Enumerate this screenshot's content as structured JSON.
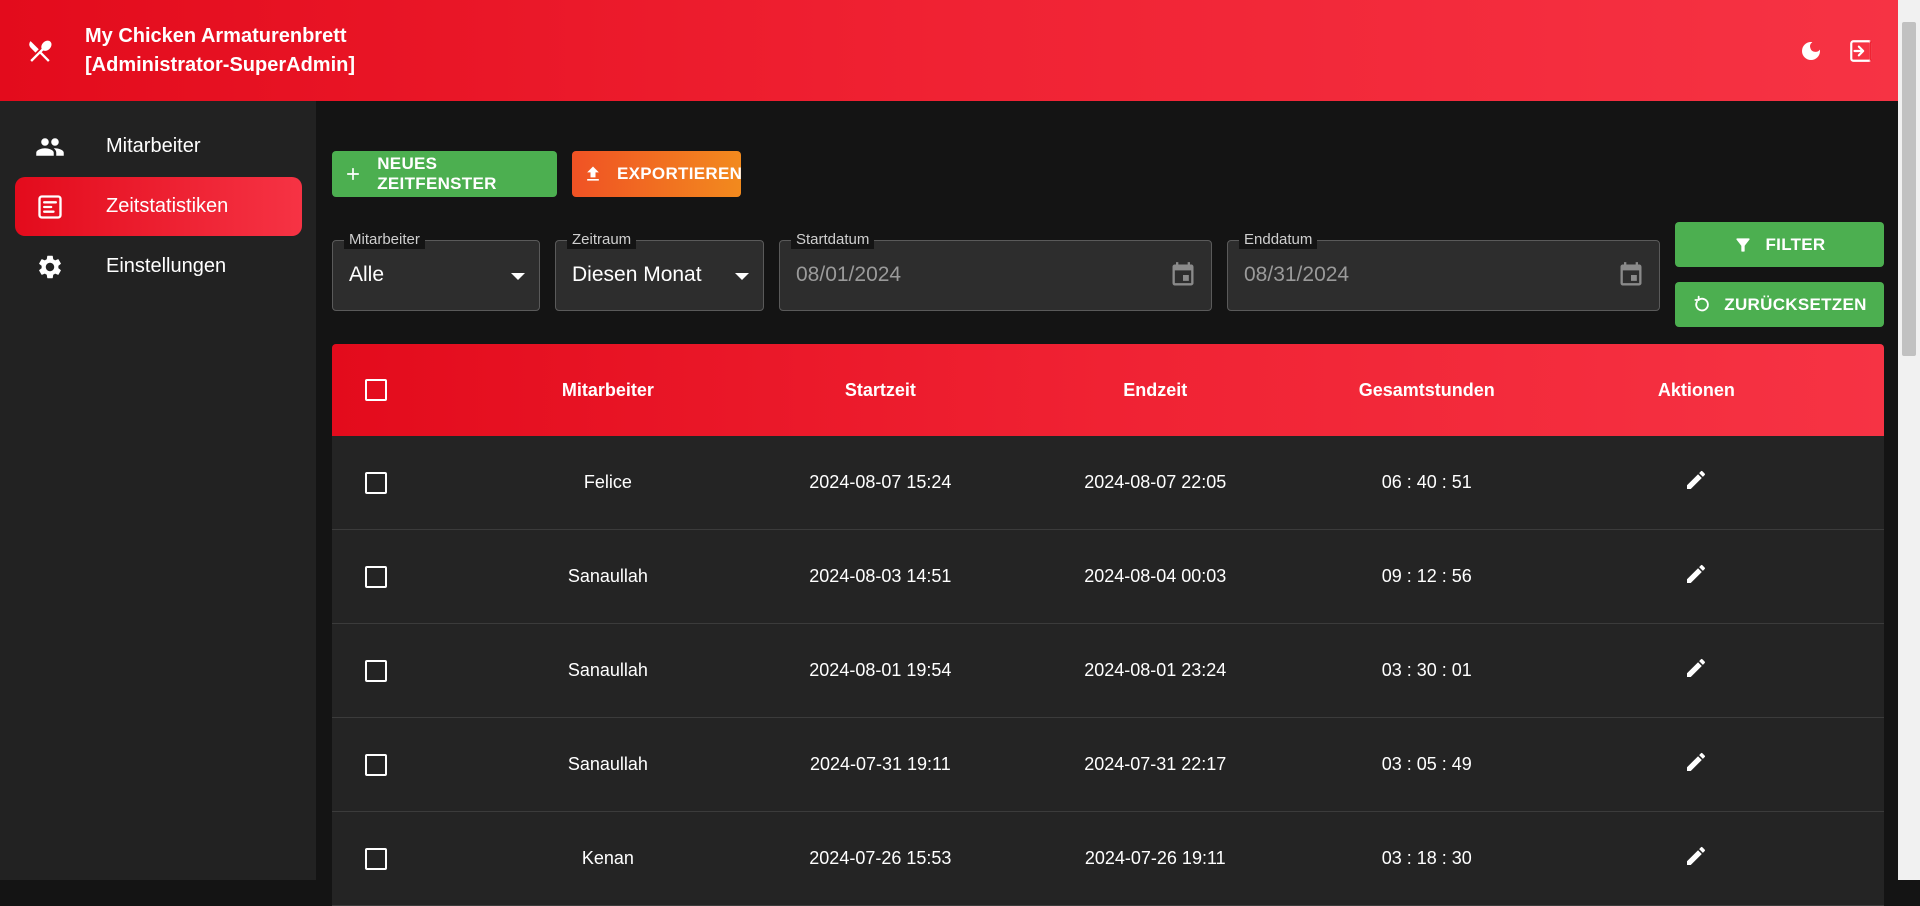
{
  "header": {
    "logo_icon": "utensils-icon",
    "title_line1": "My Chicken Armaturenbrett",
    "title_line2": "[Administrator-SuperAdmin]",
    "theme_icon": "moon-icon",
    "logout_icon": "logout-icon"
  },
  "sidebar": {
    "items": [
      {
        "label": "Mitarbeiter",
        "icon": "people-icon",
        "active": false
      },
      {
        "label": "Zeitstatistiken",
        "icon": "report-icon",
        "active": true
      },
      {
        "label": "Einstellungen",
        "icon": "gear-icon",
        "active": false
      }
    ]
  },
  "toolbar": {
    "new_label": "NEUES ZEITFENSTER",
    "export_label": "EXPORTIEREN",
    "filter_label": "FILTER",
    "reset_label": "ZURÜCKSETZEN"
  },
  "filters": {
    "employee": {
      "label": "Mitarbeiter",
      "value": "Alle"
    },
    "period": {
      "label": "Zeitraum",
      "value": "Diesen Monat"
    },
    "start": {
      "label": "Startdatum",
      "value": "08/01/2024"
    },
    "end": {
      "label": "Enddatum",
      "value": "08/31/2024"
    }
  },
  "table": {
    "columns": [
      "Mitarbeiter",
      "Startzeit",
      "Endzeit",
      "Gesamtstunden",
      "Aktionen"
    ],
    "rows": [
      {
        "employee": "Felice",
        "start": "2024-08-07 15:24",
        "end": "2024-08-07 22:05",
        "total": "06 : 40 : 51"
      },
      {
        "employee": "Sanaullah",
        "start": "2024-08-03 14:51",
        "end": "2024-08-04 00:03",
        "total": "09 : 12 : 56"
      },
      {
        "employee": "Sanaullah",
        "start": "2024-08-01 19:54",
        "end": "2024-08-01 23:24",
        "total": "03 : 30 : 01"
      },
      {
        "employee": "Sanaullah",
        "start": "2024-07-31 19:11",
        "end": "2024-07-31 22:17",
        "total": "03 : 05 : 49"
      },
      {
        "employee": "Kenan",
        "start": "2024-07-26 15:53",
        "end": "2024-07-26 19:11",
        "total": "03 : 18 : 30"
      }
    ]
  },
  "colors": {
    "accent": "#e30b1c",
    "green": "#4caf50",
    "orange": "#f05224"
  }
}
